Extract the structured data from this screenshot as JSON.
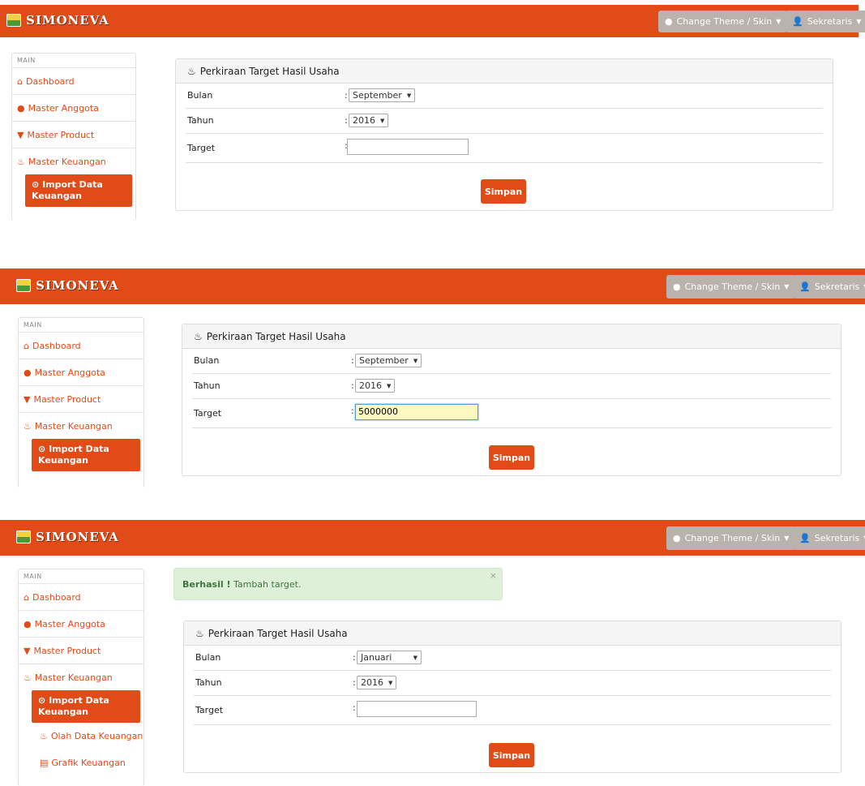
{
  "colors": {
    "brand": "#e04b17",
    "alert_bg": "#dff0d8",
    "alert_text": "#3c763d"
  },
  "brand": {
    "name": "SIMONEVA",
    "logo_icon": "logo-icon"
  },
  "nav": {
    "theme_label": "Change Theme / Skin",
    "theme_icon": "droplet-icon",
    "user_label": "Sekretaris",
    "user_icon": "user-icon"
  },
  "sidebar": {
    "heading": "MAIN",
    "items": [
      {
        "label": "Dashboard",
        "icon": "home-icon"
      },
      {
        "label": "Master Anggota",
        "icon": "user-icon"
      },
      {
        "label": "Master Product",
        "icon": "cart-icon"
      },
      {
        "label": "Master Keuangan",
        "icon": "fire-icon"
      }
    ],
    "sub_active": {
      "line1": "Import Data",
      "line2": "Keuangan",
      "icon": "upload-icon"
    },
    "sub_items": [
      {
        "label": "Olah Data Keuangan",
        "icon": "fire-icon"
      },
      {
        "label": "Grafik Keuangan",
        "icon": "table-icon"
      }
    ]
  },
  "form": {
    "title": "Perkiraan Target Hasil Usaha",
    "title_icon": "fire-icon",
    "labels": {
      "bulan": "Bulan",
      "tahun": "Tahun",
      "target": "Target"
    },
    "colon": ":",
    "submit": "Simpan"
  },
  "screen1": {
    "bulan": "September",
    "tahun": "2016",
    "target": ""
  },
  "screen2": {
    "bulan": "September",
    "tahun": "2016",
    "target": "5000000"
  },
  "screen3": {
    "bulan": "Januari",
    "tahun": "2016",
    "target": "",
    "alert_strong": "Berhasil !",
    "alert_text": "Tambah target.",
    "alert_close": "×"
  }
}
